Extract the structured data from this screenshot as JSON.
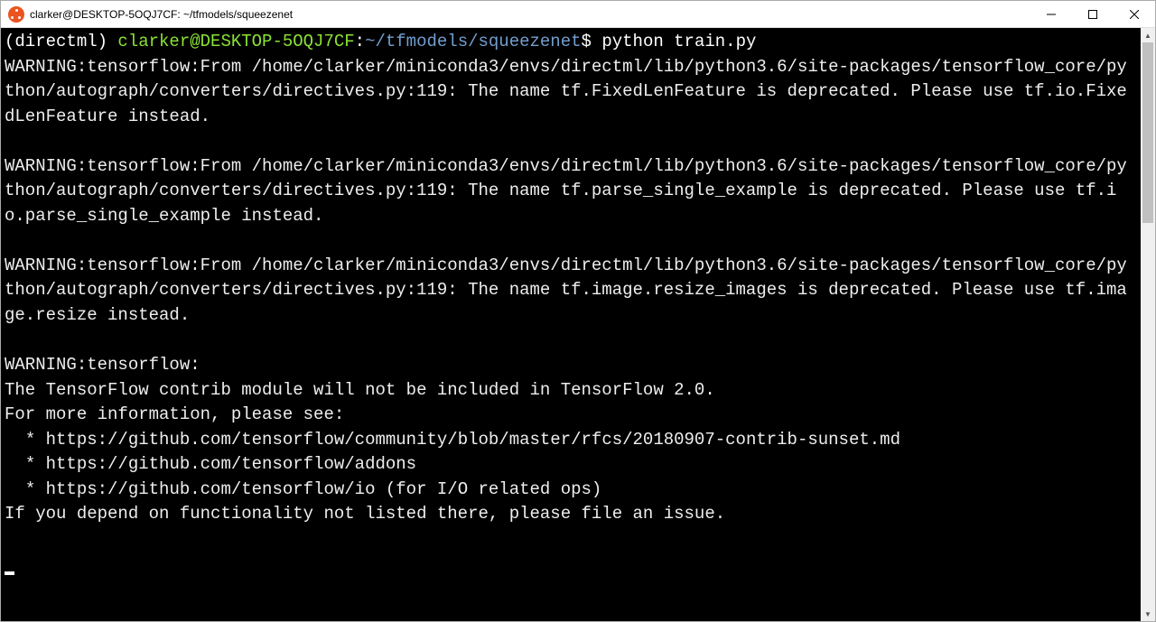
{
  "window": {
    "title": "clarker@DESKTOP-5OQJ7CF: ~/tfmodels/squeezenet"
  },
  "prompt": {
    "env": "(directml) ",
    "user_host": "clarker@DESKTOP-5OQJ7CF",
    "colon": ":",
    "path": "~/tfmodels/squeezenet",
    "dollar": "$ ",
    "command": "python train.py"
  },
  "output": {
    "block1": "WARNING:tensorflow:From /home/clarker/miniconda3/envs/directml/lib/python3.6/site-packages/tensorflow_core/python/autograph/converters/directives.py:119: The name tf.FixedLenFeature is deprecated. Please use tf.io.FixedLenFeature instead.",
    "blank1": "",
    "block2": "WARNING:tensorflow:From /home/clarker/miniconda3/envs/directml/lib/python3.6/site-packages/tensorflow_core/python/autograph/converters/directives.py:119: The name tf.parse_single_example is deprecated. Please use tf.io.parse_single_example instead.",
    "blank2": "",
    "block3": "WARNING:tensorflow:From /home/clarker/miniconda3/envs/directml/lib/python3.6/site-packages/tensorflow_core/python/autograph/converters/directives.py:119: The name tf.image.resize_images is deprecated. Please use tf.image.resize instead.",
    "blank3": "",
    "block4a": "WARNING:tensorflow:",
    "block4b": "The TensorFlow contrib module will not be included in TensorFlow 2.0.",
    "block4c": "For more information, please see:",
    "block4d": "  * https://github.com/tensorflow/community/blob/master/rfcs/20180907-contrib-sunset.md",
    "block4e": "  * https://github.com/tensorflow/addons",
    "block4f": "  * https://github.com/tensorflow/io (for I/O related ops)",
    "block4g": "If you depend on functionality not listed there, please file an issue.",
    "blank4": ""
  }
}
